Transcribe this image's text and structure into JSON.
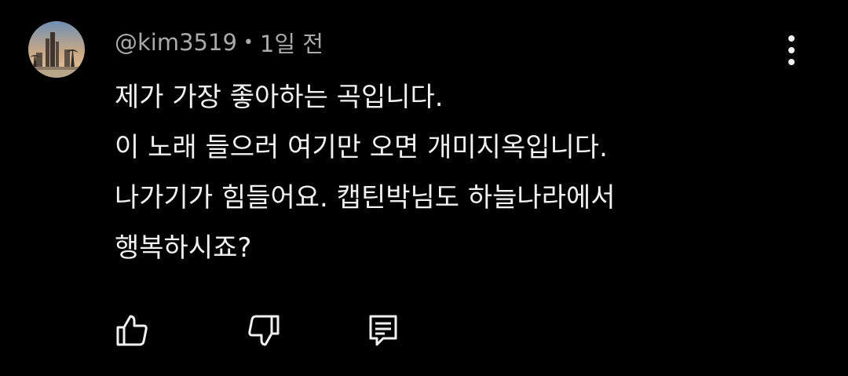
{
  "comment": {
    "author_handle": "@kim3519",
    "separator": "•",
    "timestamp": "1일 전",
    "lines": [
      "제가 가장 좋아하는 곡입니다.",
      "이 노래 들으러 여기만 오면 개미지옥입니다.",
      "나가기가 힘들어요. 캡틴박님도 하늘나라에서",
      "행복하시죠?"
    ],
    "avatar_icon": "avatar-city-skyline",
    "menu_icon": "more-vertical-icon"
  },
  "actions": {
    "like_icon": "thumb-up-icon",
    "dislike_icon": "thumb-down-icon",
    "reply_icon": "reply-comment-icon"
  },
  "colors": {
    "background": "#000000",
    "text_primary": "#f1f1f1",
    "text_secondary": "#aaaaaa"
  }
}
